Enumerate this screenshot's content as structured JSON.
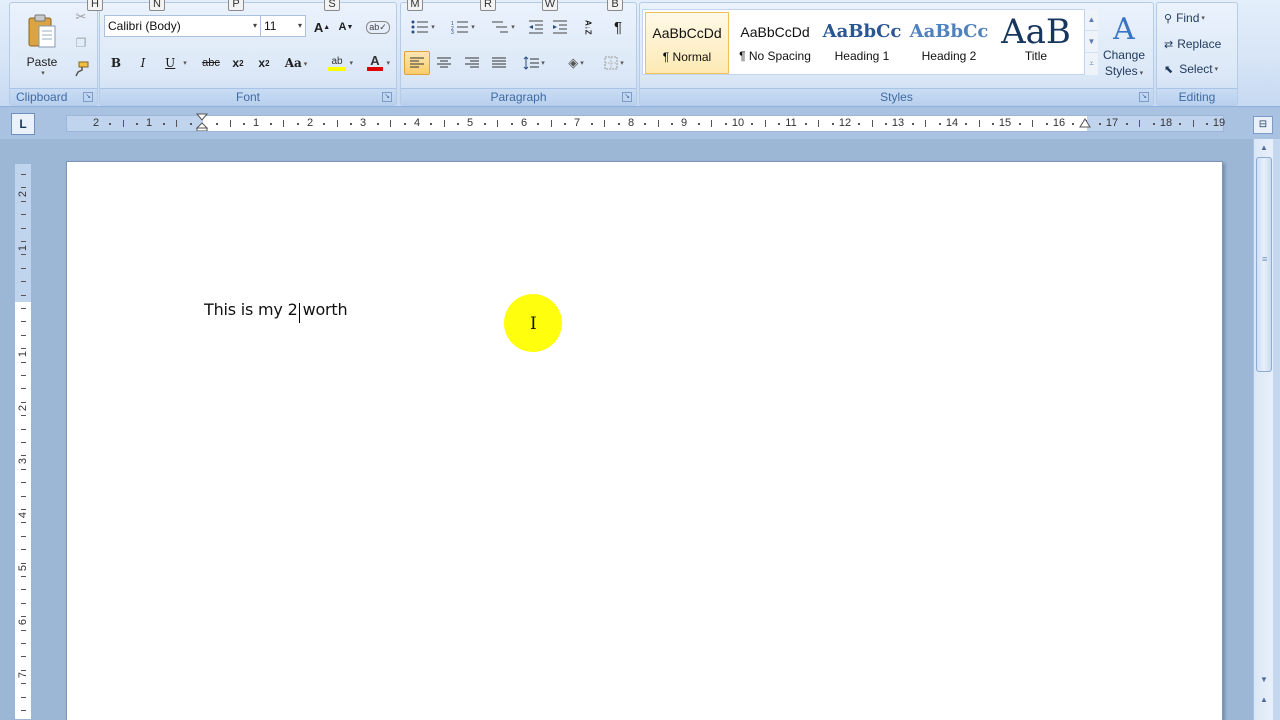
{
  "keytips": {
    "h": "H",
    "n": "N",
    "p": "P",
    "s": "S",
    "m": "M",
    "r": "R",
    "w": "W",
    "b": "B"
  },
  "clipboard": {
    "group_label": "Clipboard",
    "paste_label": "Paste"
  },
  "font": {
    "group_label": "Font",
    "font_name": "Calibri (Body)",
    "font_size": "11",
    "grow_label": "A",
    "shrink_label": "A",
    "bold": "B",
    "italic": "I",
    "underline": "U",
    "strikethrough": "abc",
    "subscript": "x",
    "subscript_mark": "2",
    "superscript": "x",
    "superscript_mark": "2",
    "change_case": "Aa",
    "highlight_glyph": "ab",
    "font_color_glyph": "A",
    "highlight_color": "#ffff00",
    "font_color": "#e00000"
  },
  "paragraph": {
    "group_label": "Paragraph",
    "show_marks": "¶",
    "sort": "A↓Z"
  },
  "styles": {
    "group_label": "Styles",
    "items": [
      {
        "sample": "AaBbCcDd",
        "name": "¶ Normal"
      },
      {
        "sample": "AaBbCcDd",
        "name": "¶ No Spacing"
      },
      {
        "sample": "AaBbCc",
        "name": "Heading 1"
      },
      {
        "sample": "AaBbCc",
        "name": "Heading 2"
      },
      {
        "sample": "AaB",
        "name": "Title"
      }
    ],
    "change_styles_line1": "Change",
    "change_styles_line2": "Styles"
  },
  "editing": {
    "group_label": "Editing",
    "find": "Find",
    "replace": "Replace",
    "select": "Select"
  },
  "ruler": {
    "tab_selector": "L",
    "left_numbers": [
      "2",
      "1"
    ],
    "numbers": [
      "1",
      "2",
      "3",
      "4",
      "5",
      "6",
      "7",
      "8",
      "9",
      "10",
      "11",
      "12",
      "13",
      "14",
      "15",
      "16",
      "17",
      "18",
      "19"
    ],
    "vertical_numbers": [
      "2",
      "1",
      "1",
      "2",
      "3",
      "4",
      "5",
      "6",
      "7"
    ]
  },
  "document": {
    "text_before_caret": "This is my 2",
    "text_after_caret": "worth"
  },
  "colors": {
    "accent": "#1e395b",
    "ribbon_label": "#3e6aa2",
    "cursor_highlight": "#ffff00"
  }
}
